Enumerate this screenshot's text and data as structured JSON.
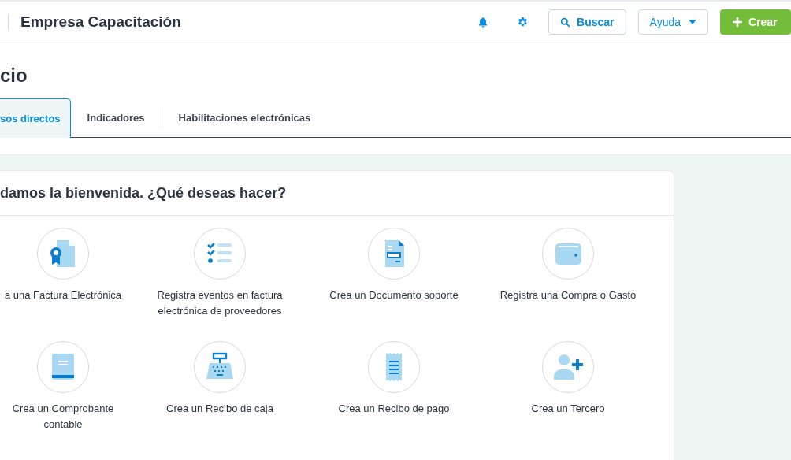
{
  "header": {
    "company": "Empresa Capacitación",
    "search_button": "Buscar",
    "help_button": "Ayuda",
    "create_button": "Crear"
  },
  "page_title": "cio",
  "tabs": [
    {
      "label": "sos directos",
      "selected": true
    },
    {
      "label": "Indicadores",
      "selected": false
    },
    {
      "label": "Habilitaciones electrónicas",
      "selected": false
    }
  ],
  "card": {
    "title": "damos la bienvenida. ¿Qué deseas hacer?",
    "actions": [
      {
        "kind": "invoice",
        "label": "a una Factura Electrónica"
      },
      {
        "kind": "checklist",
        "label": "Registra eventos en factura electrónica de proveedores"
      },
      {
        "kind": "document",
        "label": "Crea un Documento soporte"
      },
      {
        "kind": "wallet",
        "label": "Registra una Compra o Gasto"
      },
      {
        "kind": "book",
        "label": "Crea un Comprobante contable"
      },
      {
        "kind": "register",
        "label": "Crea un Recibo de caja"
      },
      {
        "kind": "receipt",
        "label": "Crea un Recibo de pago"
      },
      {
        "kind": "person-add",
        "label": "Crea un Tercero"
      }
    ]
  }
}
